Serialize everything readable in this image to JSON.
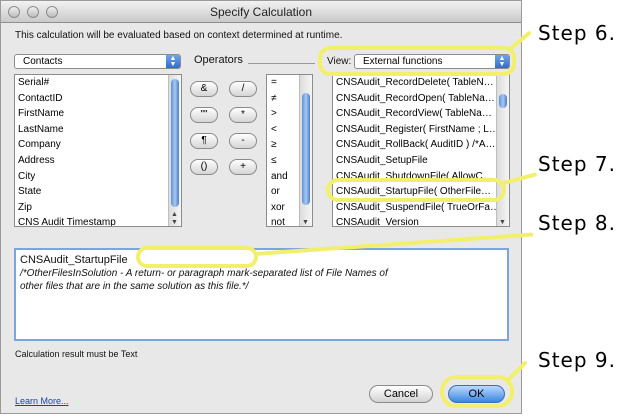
{
  "window": {
    "title": "Specify Calculation"
  },
  "description": "This calculation will be evaluated based on context determined at runtime.",
  "table_selector": {
    "value": "Contacts"
  },
  "fields": [
    "Serial#",
    "ContactID",
    "FirstName",
    "LastName",
    "Company",
    "Address",
    "City",
    "State",
    "Zip",
    "CNS Audit Timestamp"
  ],
  "operators_label": "Operators",
  "operator_buttons": [
    "&",
    "/",
    "\"\"",
    "*",
    "¶",
    "-",
    "()",
    "+"
  ],
  "operator_list": [
    "=",
    "≠",
    ">",
    "<",
    "≥",
    "≤",
    "and",
    "or",
    "xor",
    "not"
  ],
  "view_label": "View:",
  "view_selector": {
    "value": "External functions"
  },
  "functions": [
    "CNSAudit_RecordDelete( TableN…",
    "CNSAudit_RecordOpen( TableNa…",
    "CNSAudit_RecordView( TableNa…",
    "CNSAudit_Register( FirstName ; L…",
    "CNSAudit_RollBack( AuditID ) /*A…",
    "CNSAudit_SetupFile",
    "CNSAudit_ShutdownFile( AllowC…",
    "CNSAudit_StartupFile( OtherFile…",
    "CNSAudit_SuspendFile( TrueOrFa…",
    "CNSAudit_Version"
  ],
  "formula": {
    "line1": "CNSAudit_StartupFile",
    "line2": "/*OtherFilesInSolution - A return- or paragraph mark-separated list of File Names of",
    "line3": "other files that are in the same solution as this file.*/"
  },
  "result_type": "Calculation result must be Text",
  "learn_more": "Learn More...",
  "buttons": {
    "cancel": "Cancel",
    "ok": "OK"
  },
  "annotations": [
    "Step 6.",
    "Step 7.",
    "Step 8.",
    "Step 9."
  ],
  "colors": {
    "highlight": "#f2f06a",
    "default_button": "#5aa0ea",
    "selection": "#3875d7"
  }
}
